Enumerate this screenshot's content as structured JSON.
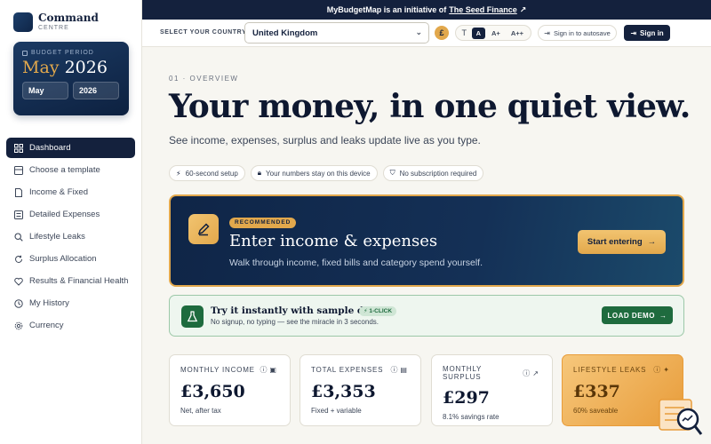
{
  "brand": {
    "name": "Command",
    "sub": "CENTRE"
  },
  "budget": {
    "label": "BUDGET PERIOD",
    "month_display": "May",
    "year_display": "2026",
    "month_value": "May",
    "year_value": "2026"
  },
  "nav": {
    "items": [
      {
        "label": "Dashboard",
        "icon": "grid-icon",
        "active": true
      },
      {
        "label": "Choose a template",
        "icon": "template-icon"
      },
      {
        "label": "Income & Fixed",
        "icon": "file-icon"
      },
      {
        "label": "Detailed Expenses",
        "icon": "list-icon"
      },
      {
        "label": "Lifestyle Leaks",
        "icon": "search-icon"
      },
      {
        "label": "Surplus Allocation",
        "icon": "refresh-icon"
      },
      {
        "label": "Results & Financial Health",
        "icon": "heart-icon"
      },
      {
        "label": "My History",
        "icon": "history-icon"
      },
      {
        "label": "Currency",
        "icon": "gear-icon"
      }
    ]
  },
  "banner": {
    "prefix": "MyBudgetMap is an initiative of",
    "link": "The Seed Finance",
    "arrow": "↗"
  },
  "toolbar": {
    "country_label": "SELECT YOUR COUNTRY",
    "country_value": "United Kingdom",
    "currency_symbol": "£",
    "font_sizes": [
      "A",
      "A+",
      "A++"
    ],
    "autosave_label": "Sign in to autosave",
    "signin_label": "Sign in"
  },
  "hero": {
    "eyebrow": "01 · OVERVIEW",
    "title": "Your money, in one quiet view.",
    "subtitle": "See income, expenses, surplus and leaks update live as you type.",
    "chips": [
      "60-second setup",
      "Your numbers stay on this device",
      "No subscription required"
    ]
  },
  "cta": {
    "badge": "RECOMMENDED",
    "title": "Enter income & expenses",
    "subtitle": "Walk through income, fixed bills and category spend yourself.",
    "button": "Start entering"
  },
  "demo": {
    "title": "Try it instantly with sample data",
    "badge": "1-CLICK",
    "subtitle": "No signup, no typing — see the miracle in 3 seconds.",
    "button": "LOAD DEMO"
  },
  "kpis": [
    {
      "label": "MONTHLY INCOME",
      "value": "£3,650",
      "sub": "Net, after tax"
    },
    {
      "label": "TOTAL EXPENSES",
      "value": "£3,353",
      "sub": "Fixed + variable"
    },
    {
      "label": "MONTHLY SURPLUS",
      "value": "£297",
      "sub": "8.1% savings rate"
    },
    {
      "label": "LIFESTYLE LEAKS",
      "value": "£337",
      "sub": "60% saveable"
    }
  ],
  "colors": {
    "navy": "#14213d",
    "gold": "#e2a84c",
    "green": "#1e6b3e",
    "page": "#f7f6f1"
  }
}
